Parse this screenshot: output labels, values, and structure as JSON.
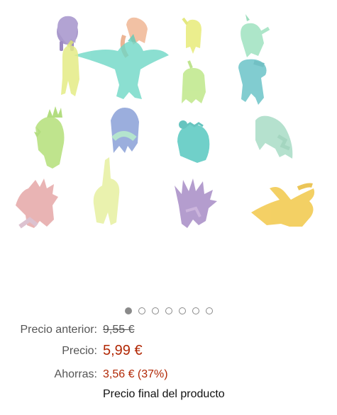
{
  "product_image": {
    "icon": "dinosaur-figures-photo"
  },
  "carousel": {
    "total": 7,
    "active_index": 0
  },
  "pricing": {
    "previous_label": "Precio anterior:",
    "previous_value": "9,55 €",
    "price_label": "Precio:",
    "price_value": "5,99 €",
    "savings_label": "Ahorras:",
    "savings_value": "3,56 € (37%)",
    "final_note": "Precio final del producto",
    "price_color": "#b12704"
  }
}
